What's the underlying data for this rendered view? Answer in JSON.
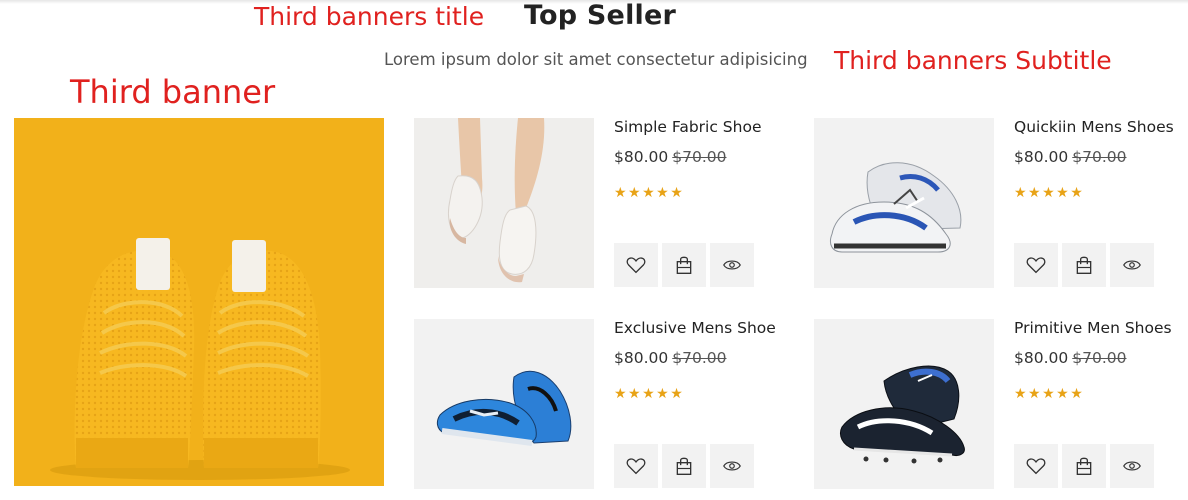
{
  "annotations": {
    "title": "Third banners title",
    "subtitle": "Third banners Subtitle",
    "banner": "Third banner"
  },
  "section": {
    "title": "Top Seller",
    "subtitle": "Lorem ipsum dolor sit amet consectetur adipisicing"
  },
  "colors": {
    "annotation": "#e0211f",
    "banner_bg": "#f1b318",
    "star": "#e8a317"
  },
  "products": [
    {
      "name": "Simple Fabric Shoe",
      "price": "$80.00",
      "old_price": "$70.00",
      "rating": "★★★★★",
      "image": "white-sneaker-on-legs"
    },
    {
      "name": "Quickiin Mens Shoes",
      "price": "$80.00",
      "old_price": "$70.00",
      "rating": "★★★★★",
      "image": "white-blue-running-shoes"
    },
    {
      "name": "Exclusive Mens Shoe",
      "price": "$80.00",
      "old_price": "$70.00",
      "rating": "★★★★★",
      "image": "blue-sport-shoes"
    },
    {
      "name": "Primitive Men Shoes",
      "price": "$80.00",
      "old_price": "$70.00",
      "rating": "★★★★★",
      "image": "black-football-boots"
    }
  ],
  "actions": [
    "heart-icon",
    "shopping-bag-icon",
    "eye-icon"
  ]
}
